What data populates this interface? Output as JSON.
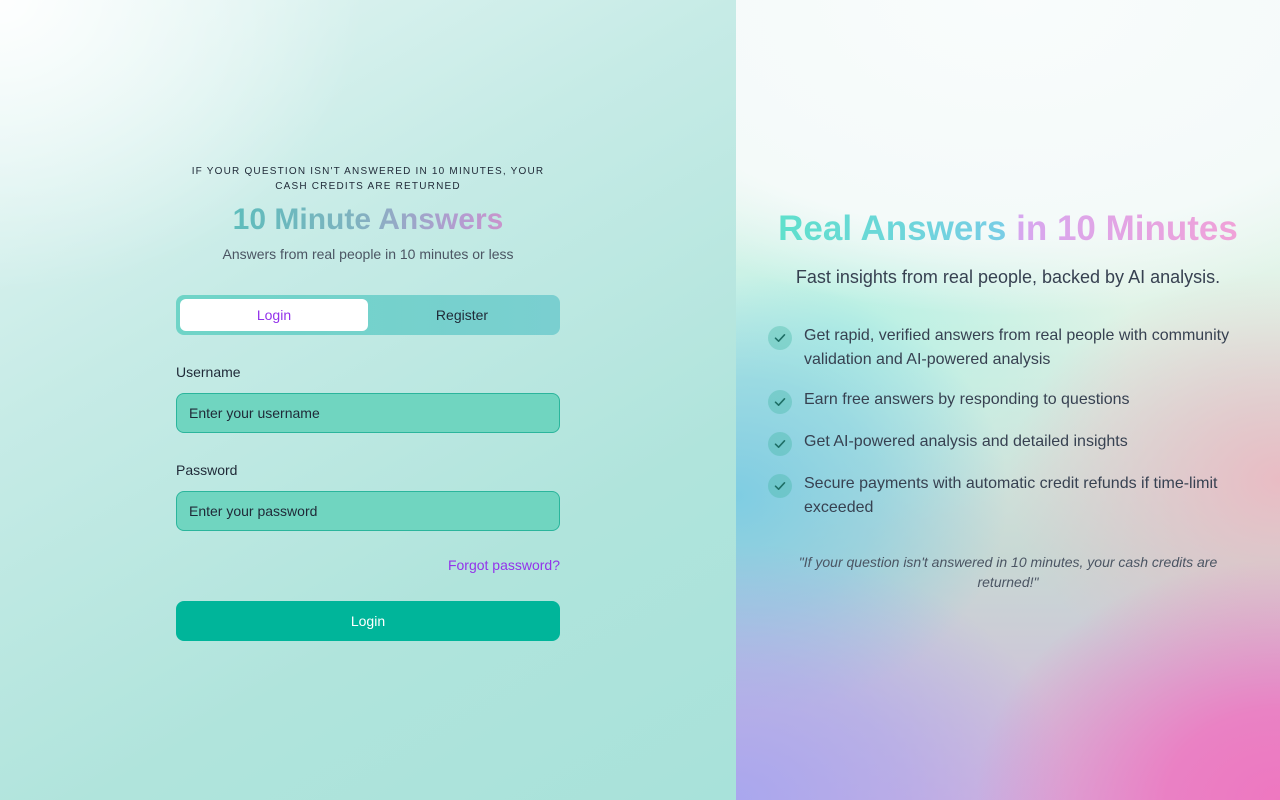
{
  "left": {
    "tagline": "IF YOUR QUESTION ISN'T ANSWERED IN 10 MINUTES, YOUR CASH CREDITS ARE RETURNED",
    "brand": "10 Minute Answers",
    "subtitle": "Answers from real people in 10 minutes or less",
    "tabs": [
      {
        "label": "Login",
        "active": true
      },
      {
        "label": "Register",
        "active": false
      }
    ],
    "username": {
      "label": "Username",
      "placeholder": "Enter your username",
      "value": ""
    },
    "password": {
      "label": "Password",
      "placeholder": "Enter your password",
      "value": ""
    },
    "forgot_label": "Forgot password?",
    "submit_label": "Login"
  },
  "right": {
    "title_part1": "Real Answers",
    "title_part2": "in 10 Minutes",
    "subtitle": "Fast insights from real people, backed by AI analysis.",
    "features": [
      {
        "icon": "check-icon",
        "text": "Get rapid, verified answers from real people with community validation and AI-powered analysis"
      },
      {
        "icon": "check-icon",
        "text": "Earn free answers by responding to questions"
      },
      {
        "icon": "check-icon",
        "text": "Get AI-powered analysis and detailed insights"
      },
      {
        "icon": "check-icon",
        "text": "Secure payments with automatic credit refunds if time-limit exceeded"
      }
    ],
    "quote": "\"If your question isn't answered in 10 minutes, your cash credits are returned!\""
  },
  "colors": {
    "accent_purple": "#9333ea",
    "primary_teal": "#00b59a",
    "input_bg": "#70d5c0"
  }
}
